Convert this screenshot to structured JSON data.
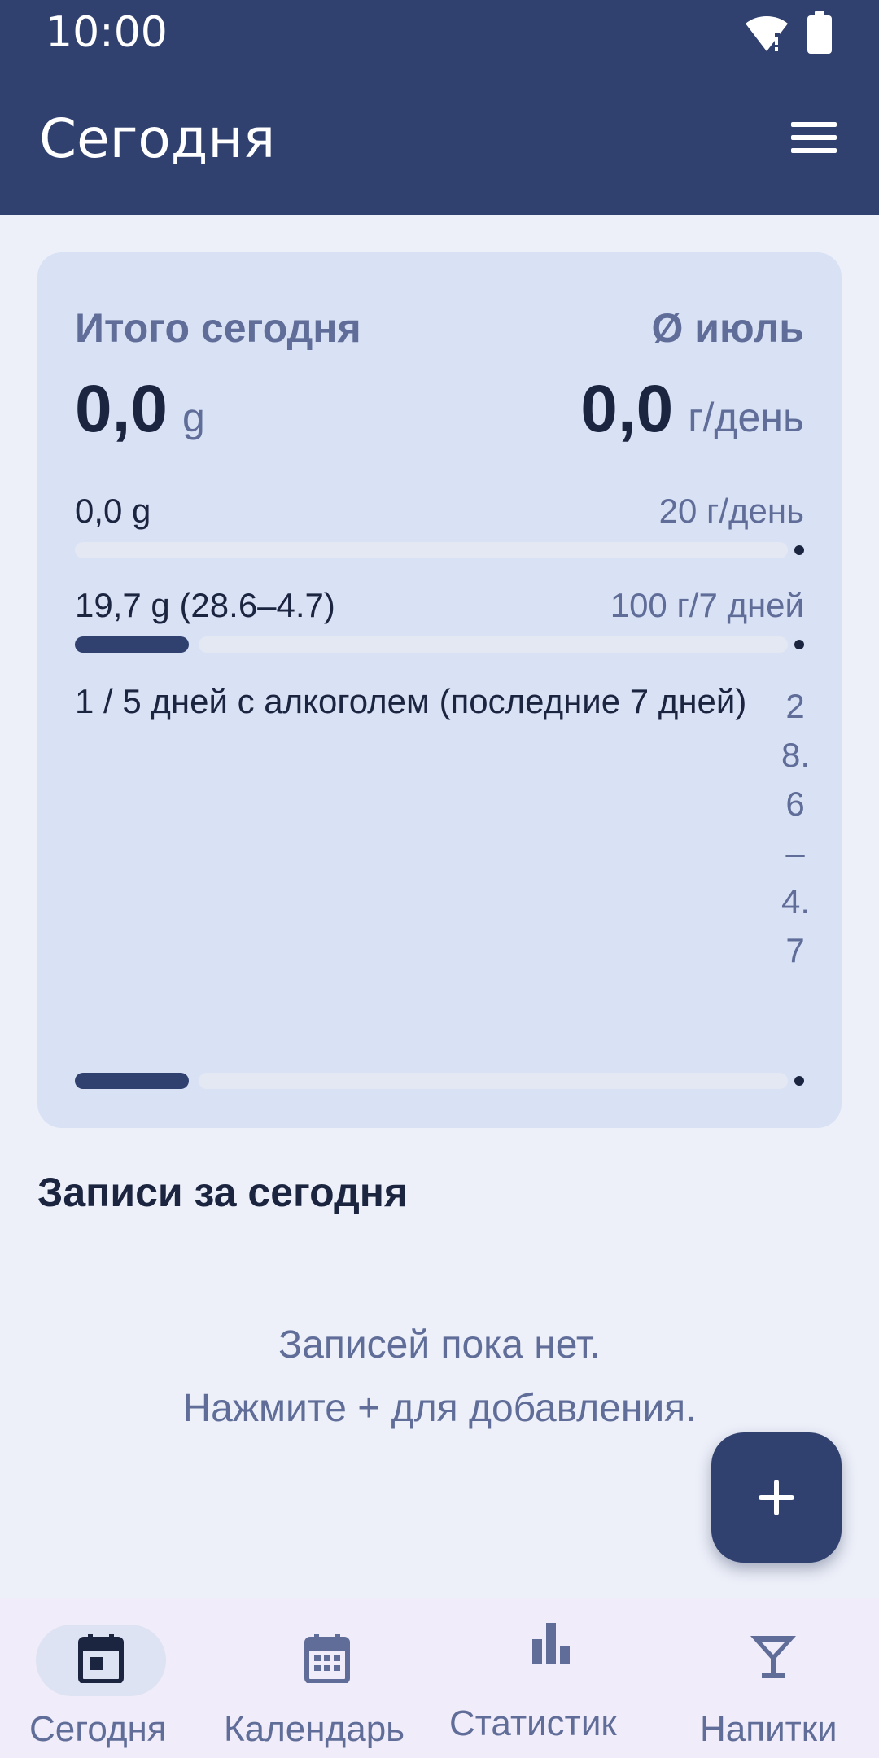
{
  "status_bar": {
    "time": "10:00",
    "icons": [
      "wifi-icon",
      "battery-icon"
    ]
  },
  "app_bar": {
    "title": "Сегодня",
    "menu_icon": "menu-icon"
  },
  "summary": {
    "left_label": "Итого сегодня",
    "left_value": "0,0",
    "left_unit": "g",
    "right_label": "Ø июль",
    "right_value": "0,0",
    "right_unit": "г/день",
    "rows": [
      {
        "left": "0,0 g",
        "right": "20 г/день",
        "progress": 0.0
      },
      {
        "left": "19,7 g (28.6–4.7)",
        "right": "100 г/7 дней",
        "progress": 0.16
      },
      {
        "left": "1 / 5 дней с алкоголем (последние 7 дней)",
        "right": "28.6–4.7",
        "progress": 0.16
      }
    ]
  },
  "entries": {
    "title": "Записи за сегодня",
    "empty_line1": "Записей пока нет.",
    "empty_line2": "Нажмите + для добавления."
  },
  "fab": {
    "label": "+",
    "icon": "plus-icon"
  },
  "bottom_nav": {
    "items": [
      {
        "label": "Сегодня",
        "icon": "calendar-today-icon",
        "active": true
      },
      {
        "label": "Календарь",
        "icon": "calendar-month-icon",
        "active": false
      },
      {
        "label": "Статистика",
        "icon": "bar-chart-icon",
        "active": false
      },
      {
        "label": "Напитки",
        "icon": "cocktail-icon",
        "active": false
      }
    ]
  },
  "colors": {
    "primary": "#30406f",
    "card": "#d9e1f5",
    "background": "#edf0f9",
    "muted_text": "#5f6d98"
  }
}
